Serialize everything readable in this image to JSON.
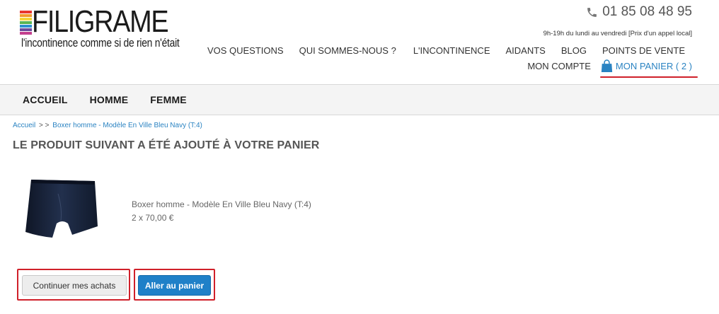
{
  "brand": {
    "name": "FILIGRAME",
    "tagline": "l'incontinence comme si de rien n'était",
    "stripe_colors": [
      "#e8352e",
      "#f29a2e",
      "#f5d43a",
      "#5ab552",
      "#2c8fd0",
      "#6a4c9c",
      "#c43f8e"
    ]
  },
  "contact": {
    "phone": "01 85 08 48 95",
    "hours": "9h-19h du lundi au vendredi [Prix d'un appel local]"
  },
  "top_nav": [
    "VOS QUESTIONS",
    "QUI SOMMES-NOUS ?",
    "L'INCONTINENCE",
    "AIDANTS",
    "BLOG",
    "POINTS DE VENTE"
  ],
  "account": {
    "label": "MON COMPTE"
  },
  "cart": {
    "label": "MON PANIER ( 2 )"
  },
  "main_nav": [
    "ACCUEIL",
    "HOMME",
    "FEMME"
  ],
  "breadcrumb": {
    "home": "Accueil",
    "separator": "> >",
    "current": "Boxer homme - Modèle En Ville Bleu Navy (T:4)"
  },
  "page": {
    "heading": "LE PRODUIT SUIVANT A ÉTÉ AJOUTÉ À VOTRE PANIER"
  },
  "product": {
    "name": "Boxer homme - Modèle En Ville Bleu Navy (T:4)",
    "quantity_price": "2 x 70,00 €",
    "color": "#1a2338"
  },
  "actions": {
    "continue_label": "Continuer mes achats",
    "go_to_cart_label": "Aller au panier"
  },
  "colors": {
    "accent": "#2a83c2",
    "highlight": "#d0202a",
    "primary_button": "#1f80c8"
  }
}
